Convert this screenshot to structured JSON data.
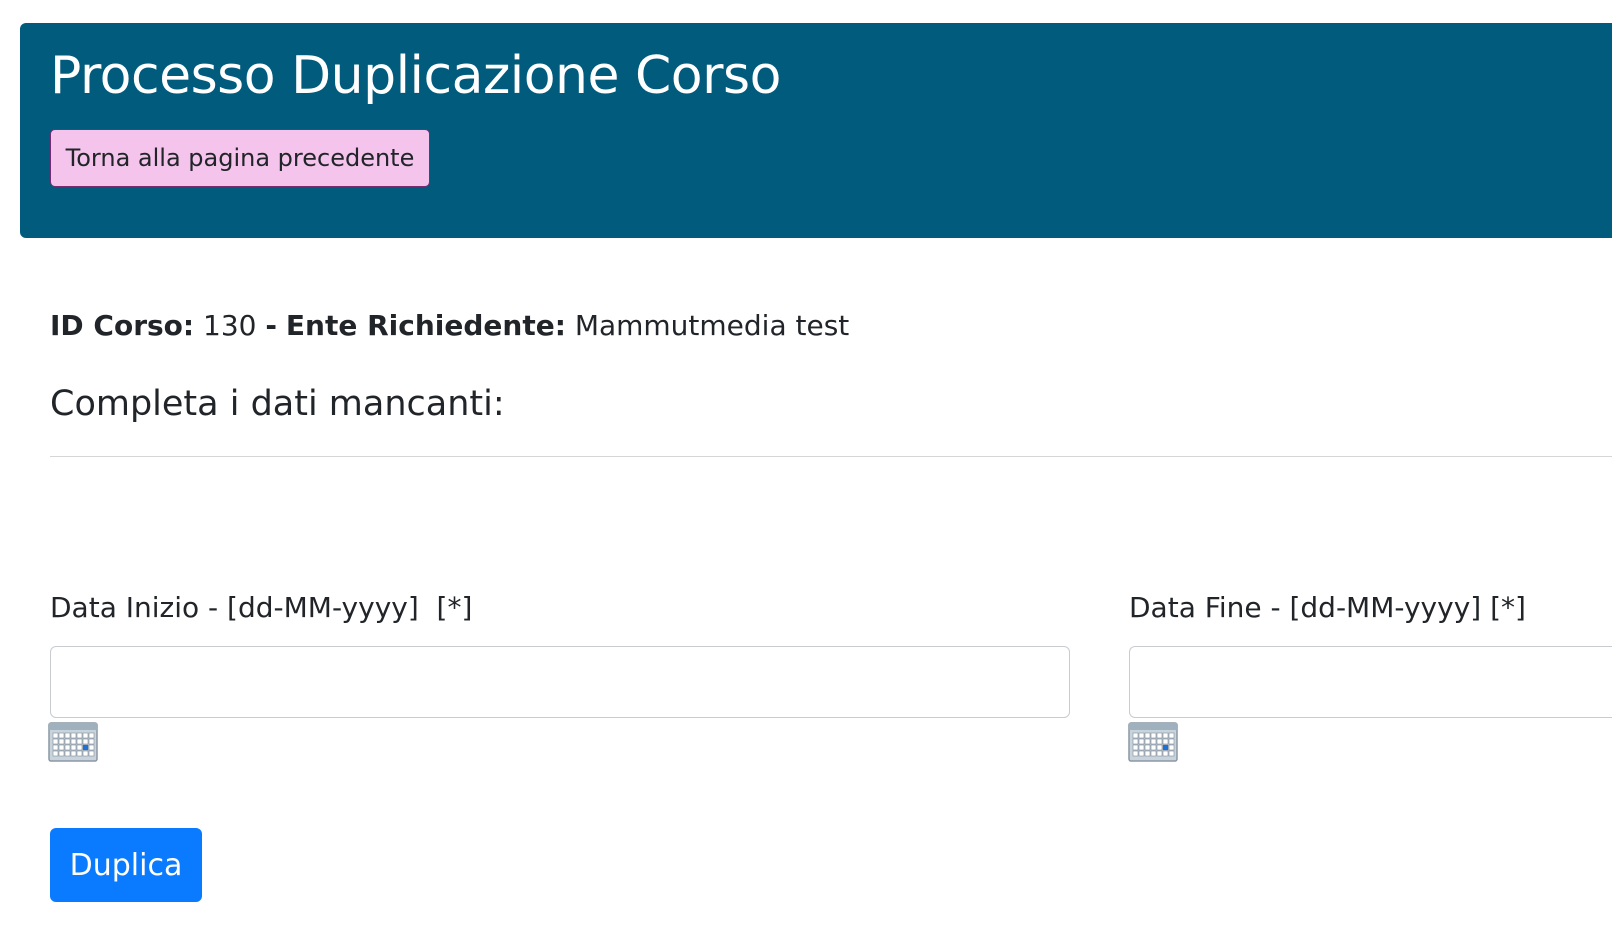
{
  "header": {
    "title": "Processo Duplicazione Corso",
    "back_label": "Torna alla pagina precedente",
    "background_color": "#005b7c"
  },
  "info": {
    "id_label": "ID Corso:",
    "id_value": "130",
    "separator": "-",
    "ente_label": "Ente Richiedente:",
    "ente_value": "Mammutmedia test"
  },
  "form": {
    "subtitle": "Completa i dati mancanti:",
    "start_date": {
      "label": "Data Inizio - [dd-MM-yyyy]  [*]",
      "value": "",
      "icon": "calendar-icon"
    },
    "end_date": {
      "label": "Data Fine - [dd-MM-yyyy] [*]",
      "value": "",
      "icon": "calendar-icon"
    },
    "submit_label": "Duplica",
    "submit_color": "#0a7bff"
  }
}
